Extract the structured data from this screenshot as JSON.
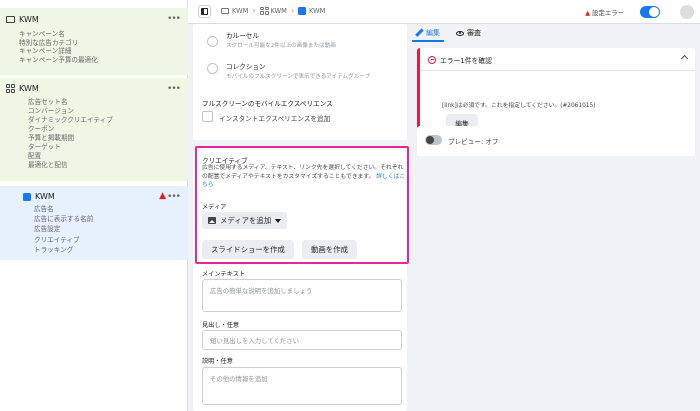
{
  "sidebar": {
    "campaign": {
      "name": "KWM",
      "items": [
        "キャンペーン名",
        "特別な広告カテゴリ",
        "キャンペーン詳細",
        "キャンペーン予算の最適化"
      ]
    },
    "adset": {
      "name": "KWM",
      "items": [
        "広告セット名",
        "コンバージョン",
        "ダイナミッククリエイティブ",
        "クーポン",
        "予算と掲載期間",
        "ターゲット",
        "配置",
        "最適化と配信"
      ]
    },
    "ad": {
      "name": "KWM",
      "items": [
        "広告名",
        "広告に表示する名前",
        "広告設定",
        "クリエイティブ",
        "トラッキング"
      ]
    }
  },
  "topbar": {
    "breadcrumbs": [
      "KWM",
      "KWM",
      "KWM"
    ],
    "settings_error": "設定エラー"
  },
  "format": {
    "carousel_title": "カルーセル",
    "carousel_sub": "スクロール可能な2件以上の画像または動画",
    "collection_title": "コレクション",
    "collection_sub": "モバイルのフルスクリーンで表示できるアイテムグループ",
    "fullscreen_title": "フルスクリーンのモバイルエクスペリエンス",
    "instant_exp_label": "インスタントエクスペリエンスを追加"
  },
  "creative": {
    "title": "クリエイティブ",
    "desc": "広告に使用するメディア、テキスト、リンク先を選択してください。それぞれの配置でメディアやテキストをカスタマイズすることもできます。",
    "learn_more": "詳しくはこちら",
    "media_label": "メディア",
    "add_media": "メディアを追加",
    "slideshow": "スライドショーを作成",
    "video": "動画を作成"
  },
  "fields": {
    "primary_label": "メインテキスト",
    "primary_placeholder": "広告の簡単な説明を追加しましょう",
    "headline_label": "見出し・任意",
    "headline_placeholder": "短い見出しを入力してください",
    "desc_label": "説明・任意",
    "desc_placeholder": "その他の情報を追加"
  },
  "tabs": {
    "edit": "編集",
    "review": "審査"
  },
  "errors": {
    "header": "エラー1件を確認",
    "message": "[link]は必須です。これを指定してください。(#2061015)",
    "edit_button": "編集"
  },
  "preview": {
    "label": "プレビュー: オフ"
  },
  "colors": {
    "accent": "#1877f2",
    "error": "#e41e3f",
    "highlight": "#e8259a"
  }
}
